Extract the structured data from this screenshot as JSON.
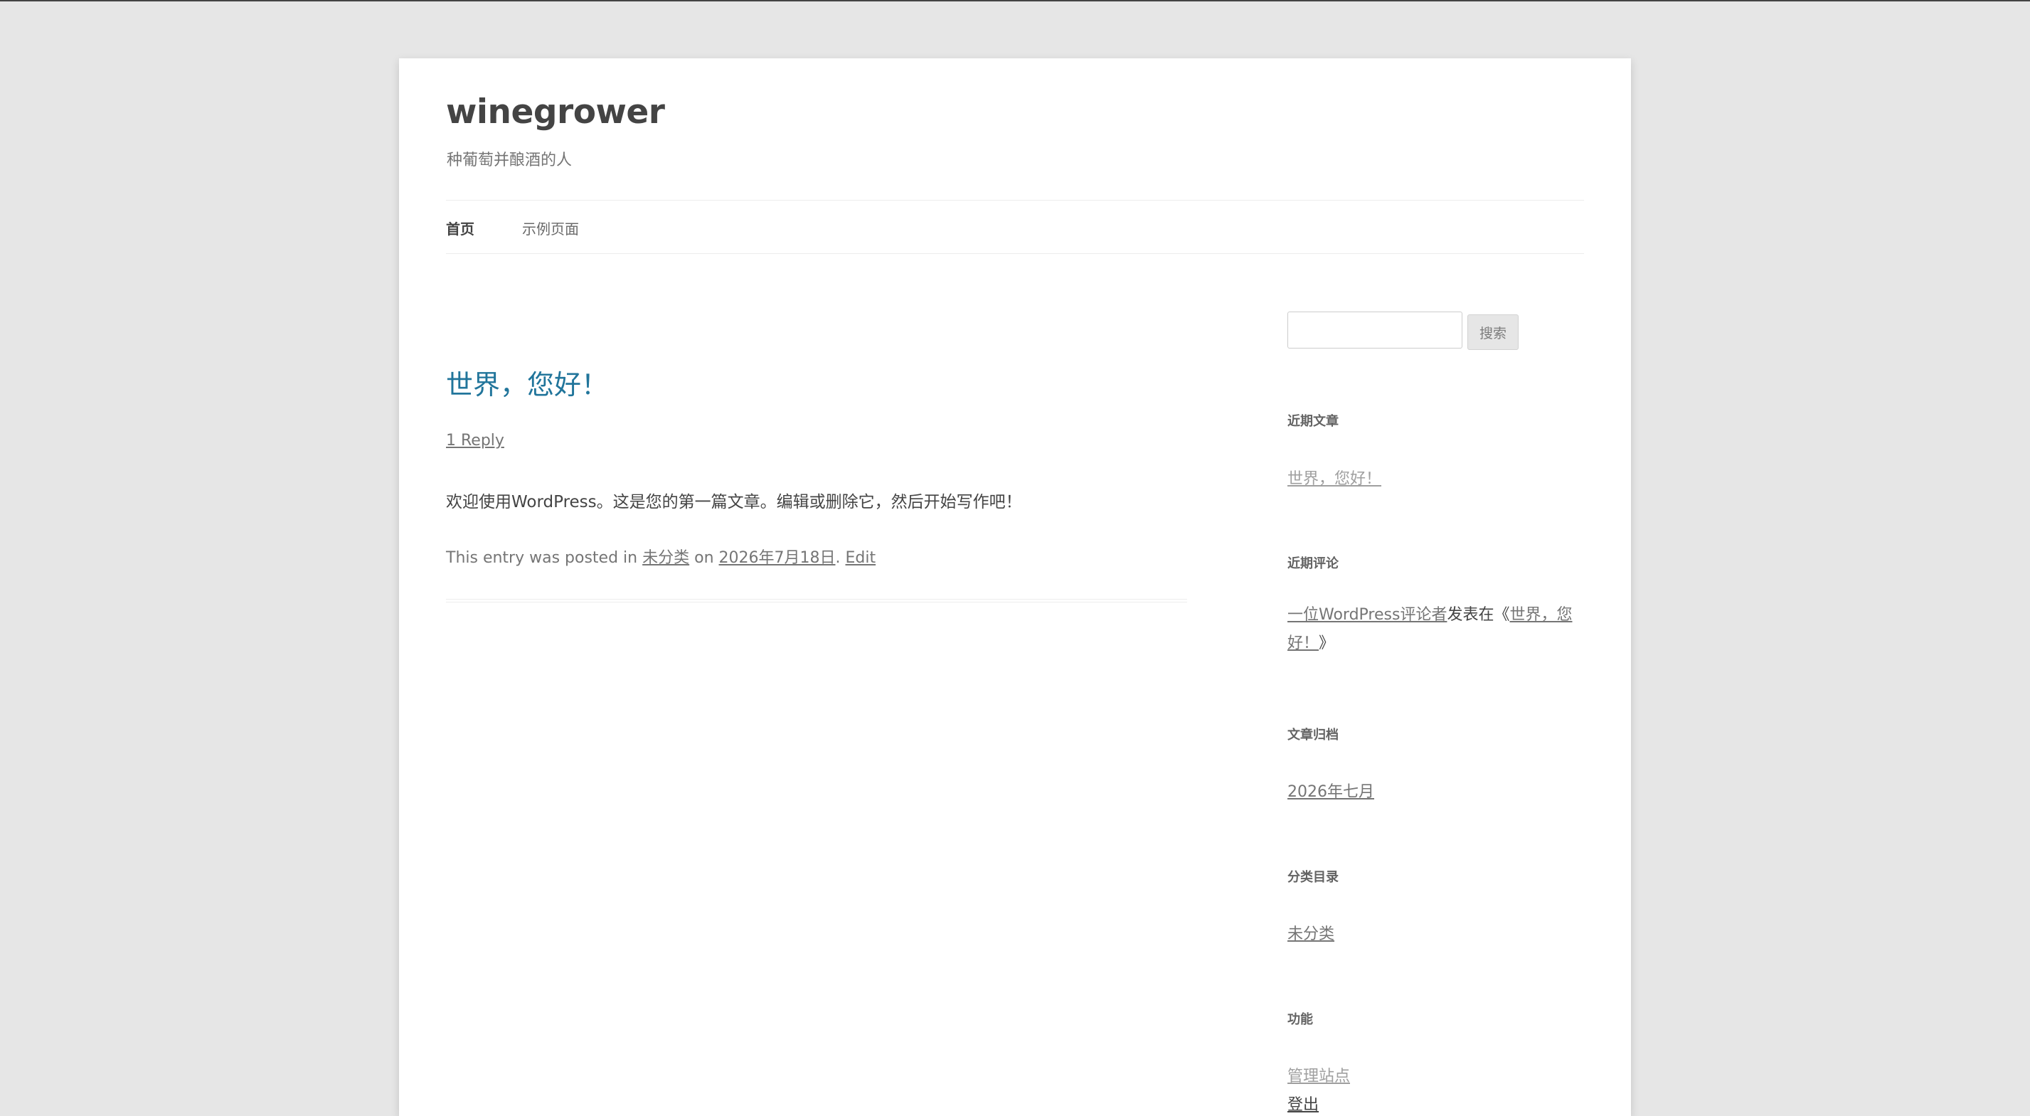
{
  "site": {
    "title": "winegrower",
    "tagline": "种葡萄并酿酒的人"
  },
  "nav": {
    "items": [
      {
        "label": "首页"
      },
      {
        "label": "示例页面"
      }
    ]
  },
  "post": {
    "title": "世界，您好！",
    "reply_link": "1 Reply",
    "body": "欢迎使用WordPress。这是您的第一篇文章。编辑或删除它，然后开始写作吧！",
    "meta": {
      "prefix": "This entry was posted in ",
      "category": "未分类",
      "on": " on ",
      "date": "2026年7月18日",
      "sep": ". ",
      "edit": "Edit"
    }
  },
  "sidebar": {
    "search": {
      "value": "",
      "button_label": "搜索"
    },
    "recent_posts": {
      "title": "近期文章",
      "items": [
        "世界，您好！"
      ]
    },
    "recent_comments": {
      "title": "近期评论",
      "author": "一位WordPress评论者",
      "mid_text": "发表在《",
      "post_line1": "世界，您",
      "post_line2": "好！",
      "end_text": "》"
    },
    "archives": {
      "title": "文章归档",
      "items": [
        "2026年七月"
      ]
    },
    "categories": {
      "title": "分类目录",
      "items": [
        "未分类"
      ]
    },
    "meta": {
      "title": "功能",
      "items": [
        "管理站点",
        "登出"
      ]
    }
  }
}
